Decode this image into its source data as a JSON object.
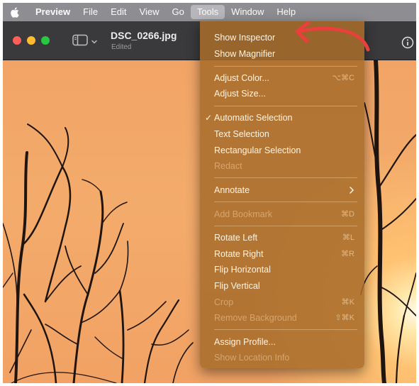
{
  "menubar": {
    "items": [
      "Preview",
      "File",
      "Edit",
      "View",
      "Go",
      "Tools",
      "Window",
      "Help"
    ],
    "active": "Tools"
  },
  "window": {
    "doc_title": "DSC_0266.jpg",
    "doc_subtitle": "Edited"
  },
  "tools_menu": {
    "show_inspector": "Show Inspector",
    "show_magnifier": "Show Magnifier",
    "adjust_color": "Adjust Color...",
    "adjust_color_shortcut": "⌥⌘C",
    "adjust_size": "Adjust Size...",
    "automatic_selection": "Automatic Selection",
    "automatic_selection_checked": true,
    "text_selection": "Text Selection",
    "rectangular_selection": "Rectangular Selection",
    "redact": "Redact",
    "annotate": "Annotate",
    "add_bookmark": "Add Bookmark",
    "add_bookmark_shortcut": "⌘D",
    "rotate_left": "Rotate Left",
    "rotate_left_shortcut": "⌘L",
    "rotate_right": "Rotate Right",
    "rotate_right_shortcut": "⌘R",
    "flip_horizontal": "Flip Horizontal",
    "flip_vertical": "Flip Vertical",
    "crop": "Crop",
    "crop_shortcut": "⌘K",
    "remove_background": "Remove Background",
    "remove_background_shortcut": "⇧⌘K",
    "assign_profile": "Assign Profile...",
    "show_location_info": "Show Location Info"
  },
  "colors": {
    "annotation_arrow": "#e8403a",
    "menubar": "#8e8e92",
    "menu_bg": "#a86c2a"
  },
  "icons": [
    "apple-logo-icon",
    "sidebar-icon",
    "chevron-down-icon",
    "info-icon",
    "submenu-arrow-icon",
    "checkmark-icon"
  ]
}
